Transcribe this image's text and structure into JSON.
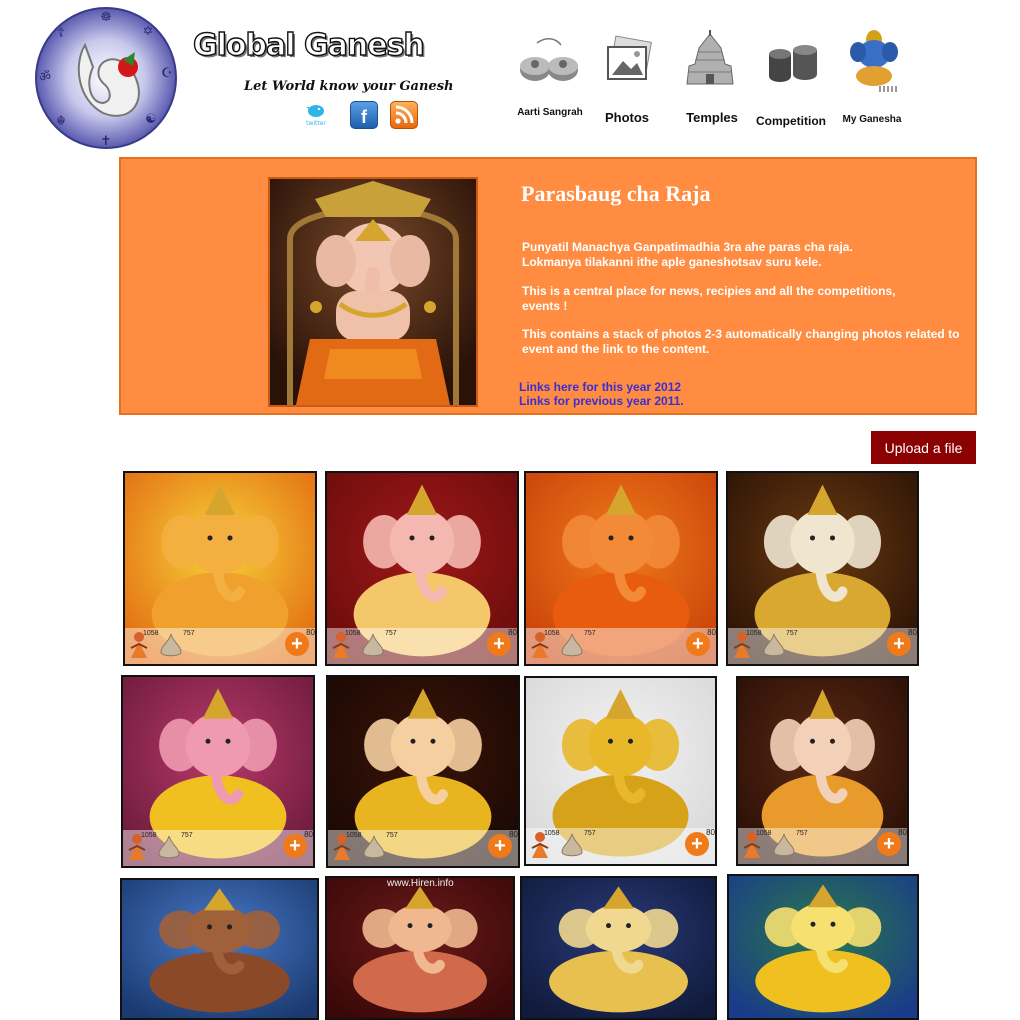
{
  "site": {
    "title": "Global Ganesh",
    "tagline": "Let World know your Ganesh",
    "twitter_text": "twitter"
  },
  "nav": [
    {
      "label": "Aarti Sangrah",
      "icon": "cymbals-icon"
    },
    {
      "label": "Photos",
      "icon": "photos-icon"
    },
    {
      "label": "Temples",
      "icon": "temple-icon"
    },
    {
      "label": "Competition",
      "icon": "drums-icon"
    },
    {
      "label": "My Ganesha",
      "icon": "ganesha-icon"
    }
  ],
  "banner": {
    "title": "Parasbaug cha Raja",
    "p1_line1": "Punyatil Manachya Ganpatimadhia 3ra ahe paras cha raja.",
    "p1_line2": "Lokmanya tilakanni ithe aple ganeshotsav suru kele.",
    "p2": "This is a central place for news, recipies and all the competitions, events !",
    "p3": "This contains a stack of photos 2-3 automatically changing photos related to event and the link to the content.",
    "link1": "Links here for this year 2012",
    "link2": "Links for previous year 2011."
  },
  "upload_label": "Upload a file",
  "tile_stats": {
    "views": "1058",
    "likes": "757",
    "percent": "80"
  },
  "watermark": "www.Hiren.info",
  "colors": {
    "banner": "#ff8c40",
    "upload_button": "#8b0000",
    "link": "#3a2fd0",
    "plus": "#f07a1a"
  }
}
